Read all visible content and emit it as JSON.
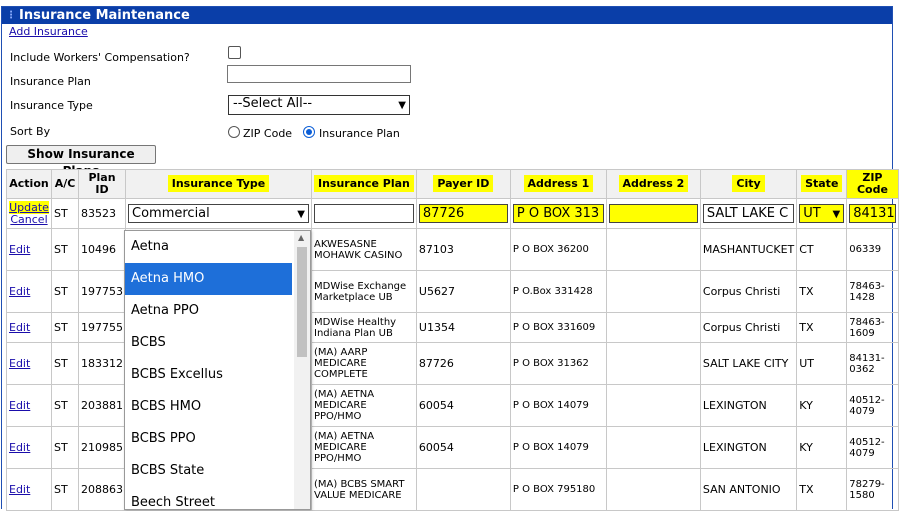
{
  "title": "Insurance Maintenance",
  "add_link": "Add Insurance",
  "form": {
    "workers_comp_label": "Include Workers' Compensation?",
    "plan_label": "Insurance Plan",
    "type_label": "Insurance Type",
    "type_value": "--Select All--",
    "sort_label": "Sort By",
    "sort_zip": "ZIP Code",
    "sort_plan": "Insurance Plan",
    "show_button": "Show Insurance Plans"
  },
  "headers": {
    "action": "Action",
    "ac": "A/C",
    "plan_id_1": "Plan",
    "plan_id_2": "ID",
    "insurance_type": "Insurance Type",
    "insurance_plan": "Insurance Plan",
    "payer_id": "Payer ID",
    "address1": "Address 1",
    "address2": "Address 2",
    "city": "City",
    "state": "State",
    "zip_1": "ZIP",
    "zip_2": "Code"
  },
  "edit_row": {
    "update": "Update",
    "cancel": "Cancel",
    "ac": "ST",
    "plan_id": "83523",
    "insurance_type": "Commercial",
    "insurance_plan": "",
    "payer_id": "87726",
    "address1": "P O BOX 313",
    "address2": "",
    "city": "SALT LAKE C",
    "state": "UT",
    "zip": "84131"
  },
  "dropdown_options": [
    "Aetna",
    "Aetna HMO",
    "Aetna PPO",
    "BCBS",
    "BCBS Excellus",
    "BCBS HMO",
    "BCBS PPO",
    "BCBS State",
    "Beech Street"
  ],
  "rows": [
    {
      "action": "Edit",
      "ac": "ST",
      "plan_id": "10496",
      "plan": "AKWESASNE MOHAWK CASINO",
      "payer": "87103",
      "addr1": "P O BOX 36200",
      "addr2": "",
      "city": "MASHANTUCKET",
      "state": "CT",
      "zip": "06339"
    },
    {
      "action": "Edit",
      "ac": "ST",
      "plan_id": "197753",
      "plan": "MDWise Exchange Marketplace UB",
      "payer": "U5627",
      "addr1": "P O.Box 331428",
      "addr2": "",
      "city": "Corpus Christi",
      "state": "TX",
      "zip": "78463-1428"
    },
    {
      "action": "Edit",
      "ac": "ST",
      "plan_id": "197755",
      "plan": "MDWise Healthy Indiana Plan UB",
      "payer": "U1354",
      "addr1": "P O BOX 331609",
      "addr2": "",
      "city": "Corpus Christi",
      "state": "TX",
      "zip": "78463-1609"
    },
    {
      "action": "Edit",
      "ac": "ST",
      "plan_id": "183312",
      "plan": "(MA) AARP MEDICARE COMPLETE",
      "payer": "87726",
      "addr1": "P O BOX 31362",
      "addr2": "",
      "city": "SALT LAKE CITY",
      "state": "UT",
      "zip": "84131-0362"
    },
    {
      "action": "Edit",
      "ac": "ST",
      "plan_id": "203881",
      "plan": "(MA) AETNA MEDICARE PPO/HMO",
      "payer": "60054",
      "addr1": "P O BOX 14079",
      "addr2": "",
      "city": "LEXINGTON",
      "state": "KY",
      "zip": "40512-4079"
    },
    {
      "action": "Edit",
      "ac": "ST",
      "plan_id": "210985",
      "plan": "(MA) AETNA MEDICARE PPO/HMO",
      "payer": "60054",
      "addr1": "P O BOX 14079",
      "addr2": "",
      "city": "LEXINGTON",
      "state": "KY",
      "zip": "40512-4079"
    },
    {
      "action": "Edit",
      "ac": "ST",
      "plan_id": "208863",
      "plan": "(MA) BCBS SMART VALUE MEDICARE",
      "payer": "",
      "addr1": "P O BOX 795180",
      "addr2": "",
      "city": "SAN ANTONIO",
      "state": "TX",
      "zip": "78279-1580"
    }
  ],
  "colors": {
    "title_bar": "#0a3ea8",
    "highlight": "#ffff00",
    "selected_option": "#1e6fd9",
    "link": "#1a0dab"
  }
}
